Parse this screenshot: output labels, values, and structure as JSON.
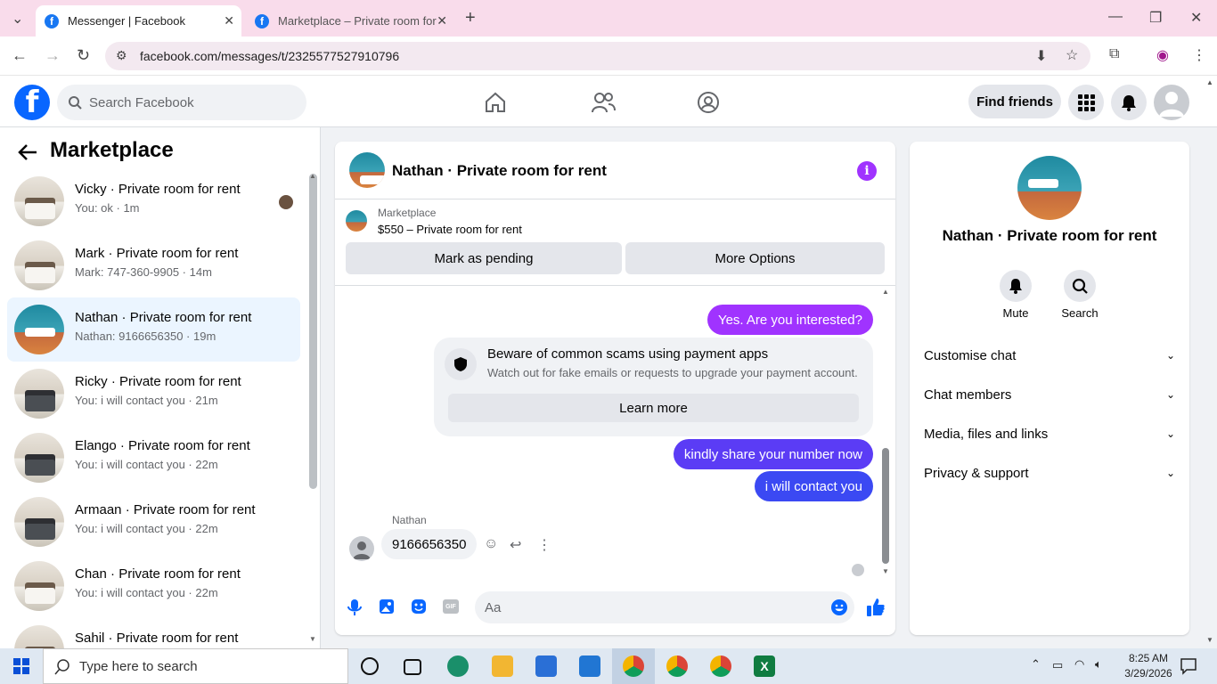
{
  "browser": {
    "tabs": [
      {
        "title": "Messenger | Facebook"
      },
      {
        "title": "Marketplace – Private room for"
      }
    ],
    "url": "facebook.com/messages/t/2325577527910796"
  },
  "header": {
    "search_placeholder": "Search Facebook",
    "find_friends": "Find friends"
  },
  "sidebar": {
    "title": "Marketplace",
    "conversations": [
      {
        "title": "Vicky · Private room for rent",
        "preview": "You: ok · 1m"
      },
      {
        "title": "Mark · Private room for rent",
        "preview": "Mark: 747-360-9905 · 14m"
      },
      {
        "title": "Nathan · Private room for rent",
        "preview": "Nathan: 9166656350 · 19m"
      },
      {
        "title": "Ricky · Private room for rent",
        "preview": "You: i will contact you · 21m"
      },
      {
        "title": "Elango · Private room for rent",
        "preview": "You: i will contact you · 22m"
      },
      {
        "title": "Armaan · Private room for rent",
        "preview": "You: i will contact you · 22m"
      },
      {
        "title": "Chan · Private room for rent",
        "preview": "You: i will contact you · 22m"
      },
      {
        "title": "Sahil · Private room for rent",
        "preview": ""
      }
    ]
  },
  "chat": {
    "title": "Nathan · Private room for rent",
    "listing_source": "Marketplace",
    "listing": "$550 – Private room for rent",
    "mark_pending": "Mark as pending",
    "more_options": "More Options",
    "messages": {
      "out1": "Yes. Are you interested?",
      "scam_title": "Beware of common scams using payment apps",
      "scam_body": "Watch out for fake emails or requests to upgrade your payment account.",
      "learn_more": "Learn more",
      "out2": "kindly share your number now",
      "out3": "i will contact you",
      "in_sender": "Nathan",
      "in1": "9166656350"
    },
    "composer_placeholder": "Aa"
  },
  "details": {
    "title": "Nathan · Private room for rent",
    "mute": "Mute",
    "search": "Search",
    "sections": [
      "Customise chat",
      "Chat members",
      "Media, files and links",
      "Privacy & support"
    ]
  },
  "taskbar": {
    "search": "Type here to search",
    "time": "8:25 AM",
    "date": "3/29/2026"
  },
  "colors": {
    "accent": "#0866ff",
    "purple": "#a033ff",
    "blue_out": "#5b3cf5"
  }
}
